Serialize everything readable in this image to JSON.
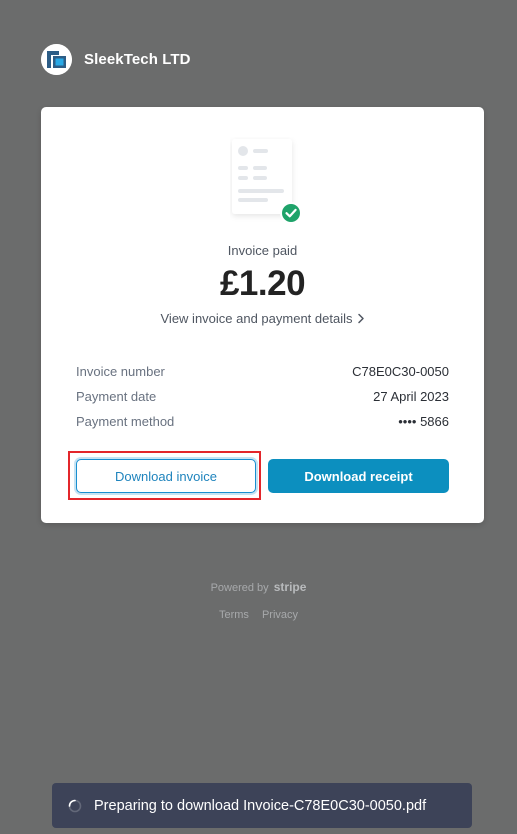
{
  "merchant": {
    "name": "SleekTech LTD",
    "logo_icon": "sleektech-logo-icon"
  },
  "invoice": {
    "status": "Invoice paid",
    "amount": "£1.20",
    "details_link": "View invoice and payment details",
    "rows": [
      {
        "label": "Invoice number",
        "value": "C78E0C30-0050"
      },
      {
        "label": "Payment date",
        "value": "27 April 2023"
      },
      {
        "label": "Payment method",
        "value": "•••• 5866"
      }
    ],
    "download_invoice_label": "Download invoice",
    "download_receipt_label": "Download receipt"
  },
  "footer": {
    "powered_by": "Powered by",
    "powered_brand": "stripe",
    "terms": "Terms",
    "privacy": "Privacy"
  },
  "toast": {
    "message": "Preparing to download Invoice-C78E0C30-0050.pdf"
  },
  "colors": {
    "backdrop": "#6b6c6c",
    "accent": "#0c8fbf",
    "success": "#1fa36a",
    "highlight": "#e3262b",
    "toast": "#3d4358"
  }
}
